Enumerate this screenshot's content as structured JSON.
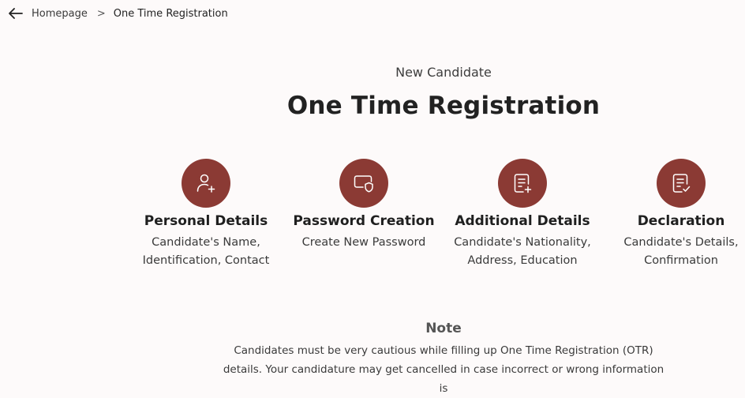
{
  "breadcrumb": {
    "back_icon": "arrow-left-icon",
    "home": "Homepage",
    "separator": ">",
    "current": "One Time Registration"
  },
  "header": {
    "subtitle": "New Candidate",
    "title": "One Time Registration"
  },
  "steps": [
    {
      "icon": "user-plus-icon",
      "title": "Personal Details",
      "desc": "Candidate's Name, Identification, Contact"
    },
    {
      "icon": "password-shield-icon",
      "title": "Password Creation",
      "desc": "Create New Password"
    },
    {
      "icon": "document-add-icon",
      "title": "Additional Details",
      "desc": "Candidate's Nationality, Address, Education"
    },
    {
      "icon": "document-check-icon",
      "title": "Declaration",
      "desc": "Candidate's Details, Confirmation"
    }
  ],
  "note": {
    "title": "Note",
    "text": "Candidates must be very cautious while filling up One Time Registration (OTR) details. Your candidature may get cancelled in case incorrect or wrong information is"
  },
  "colors": {
    "accent": "#8b3a34",
    "background": "#fdfafa"
  }
}
